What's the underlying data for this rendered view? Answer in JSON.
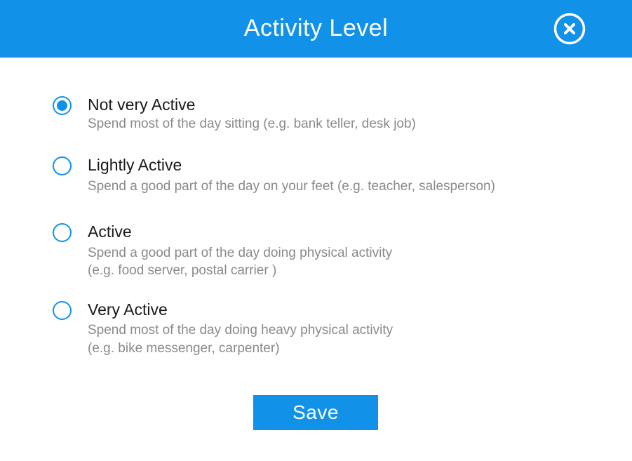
{
  "header": {
    "title": "Activity Level",
    "close_icon": "close-circle-icon"
  },
  "options": [
    {
      "label": "Not very Active",
      "description_lines": [
        "Spend most of the day sitting (e.g. bank teller, desk job)"
      ],
      "selected": true
    },
    {
      "label": "Lightly Active",
      "description_lines": [
        "Spend a good part of the day on your feet (e.g. teacher, salesperson)"
      ],
      "selected": false
    },
    {
      "label": "Active",
      "description_lines": [
        "Spend a good part of the day doing physical activity",
        "(e.g. food server, postal carrier )"
      ],
      "selected": false
    },
    {
      "label": "Very Active",
      "description_lines": [
        "Spend most of the day doing heavy physical activity",
        "(e.g. bike messenger, carpenter)"
      ],
      "selected": false
    }
  ],
  "save_label": "Save",
  "colors": {
    "accent": "#1192e8",
    "label_text": "#1a1a1a",
    "description_text": "#8a8a8a"
  }
}
